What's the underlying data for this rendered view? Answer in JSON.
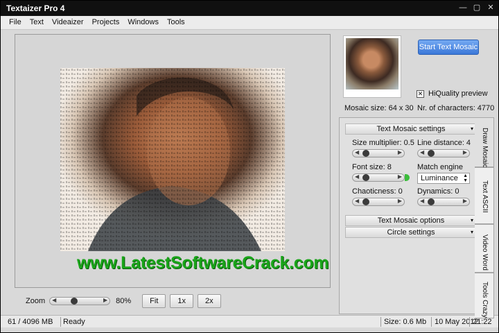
{
  "window": {
    "title": "Textaizer Pro 4",
    "controls": {
      "minimize": "—",
      "maximize": "▢",
      "close": "✕"
    }
  },
  "menu": [
    "File",
    "Text",
    "Videaizer",
    "Projects",
    "Windows",
    "Tools"
  ],
  "watermark": "www.LatestSoftwareCrack.com",
  "zoom": {
    "label": "Zoom",
    "value": "80%",
    "buttons": [
      "Fit",
      "1x",
      "2x"
    ]
  },
  "status": {
    "memory": "61 / 4096 MB",
    "state": "Ready",
    "size": "Size: 0.6 Mb",
    "date": "10 May 2012",
    "time": "21:22"
  },
  "preview": {
    "start_button": "Start Text Mosaic",
    "hq_label": "HiQuality preview",
    "hq_checked": "✕",
    "mosaic_size": "Mosaic size: 64 x 30",
    "nr_chars": "Nr. of characters: 4770"
  },
  "settings": {
    "section1": "Text Mosaic settings",
    "size_multiplier": "Size multiplier: 0.5",
    "line_distance": "Line distance: 4",
    "font_size": "Font size: 8",
    "match_engine_label": "Match engine",
    "match_engine_value": "Luminance",
    "chaoticness": "Chaoticness: 0",
    "dynamics": "Dynamics: 0",
    "section2": "Text Mosaic options",
    "section3": "Circle settings"
  },
  "tabs": [
    "Draw Mosaic",
    "Text ASCII",
    "Video Word",
    "Tools Crazy"
  ],
  "colors": {
    "accent": "#3b78d9",
    "watermark": "#1aa51a",
    "titlebar": "#101010"
  }
}
